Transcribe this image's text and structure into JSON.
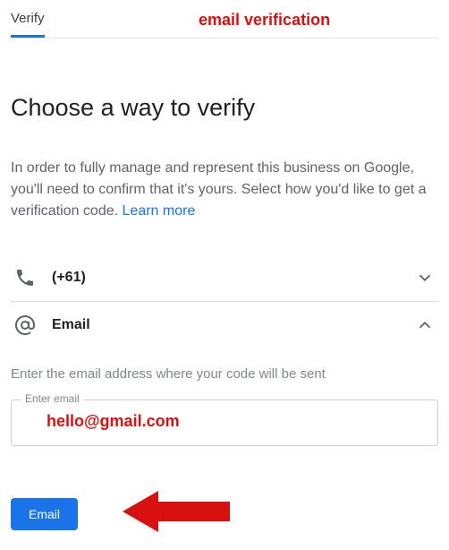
{
  "annotations": {
    "top": "email verification",
    "email_example": "hello@gmail.com"
  },
  "tab_label": "Verify",
  "title": "Choose a way to verify",
  "description": "In order to fully manage and represent this business on Google, you'll need to confirm that it's yours. Select how you'd like to get a verification code. ",
  "learn_more": "Learn more",
  "options": {
    "phone": {
      "label": "(+61)"
    },
    "email": {
      "label": "Email"
    }
  },
  "email_section": {
    "helper": "Enter the email address where your code will be sent",
    "input_legend": "Enter email",
    "input_value": ""
  },
  "submit_label": "Email"
}
